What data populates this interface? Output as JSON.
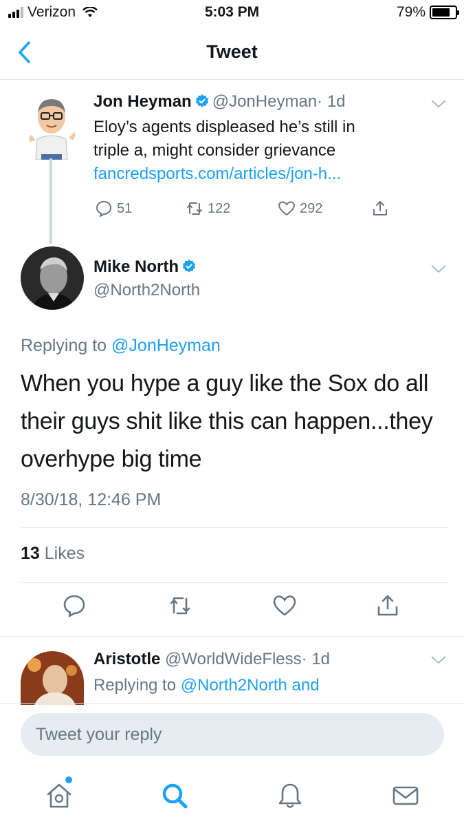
{
  "status_bar": {
    "carrier": "Verizon",
    "time": "5:03 PM",
    "battery": "79%",
    "battery_level": 0.79
  },
  "nav": {
    "title": "Tweet",
    "back_icon": "chevron-left-icon"
  },
  "quoted_tweet": {
    "name": "Jon Heyman",
    "handle": "@JonHeyman",
    "age": "· 1d",
    "text_lines": [
      "Eloy’s agents displeased he’s still in",
      "triple a, might consider grievance"
    ],
    "link": "fancredsports.com/articles/jon-h...",
    "replies": "51",
    "retweets": "122",
    "likes": "292"
  },
  "main_tweet": {
    "name": "Mike North",
    "handle": "@North2North",
    "replying_prefix": "Replying to",
    "replying_to": "@JonHeyman",
    "text": "When you hype a guy like the Sox do all their guys shit like this can happen...they overhype big time",
    "timestamp": "8/30/18, 12:46 PM",
    "likes_count": "13",
    "likes_label": "Likes"
  },
  "reply_tweet": {
    "name": "Aristotle",
    "handle": "@WorldWideFless",
    "age": "· 1d",
    "replying_prefix": "Replying to",
    "replying_to": "@North2North and"
  },
  "composer": {
    "placeholder": "Tweet your reply"
  },
  "tabs": [
    {
      "icon": "home-icon",
      "active": false,
      "badge": true
    },
    {
      "icon": "search-icon",
      "active": true
    },
    {
      "icon": "notifications-bell-icon",
      "active": false
    },
    {
      "icon": "messages-envelope-icon",
      "active": false
    }
  ],
  "colors": {
    "accent": "#1da1f2",
    "text": "#14171a",
    "secondary": "#657786",
    "divider": "#e1e8ed",
    "composer_bg": "#e6ecf0"
  }
}
